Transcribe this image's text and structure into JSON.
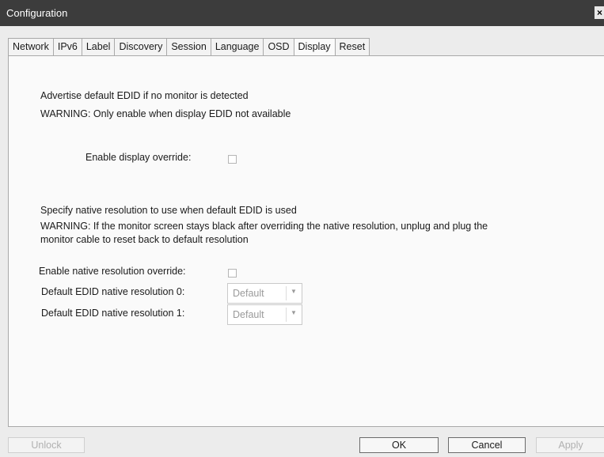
{
  "window": {
    "title": "Configuration",
    "close_label": "×"
  },
  "tabs": [
    {
      "label": "Network"
    },
    {
      "label": "IPv6"
    },
    {
      "label": "Label"
    },
    {
      "label": "Discovery"
    },
    {
      "label": "Session"
    },
    {
      "label": "Language"
    },
    {
      "label": "OSD"
    },
    {
      "label": "Display"
    },
    {
      "label": "Reset"
    }
  ],
  "active_tab": "Display",
  "display": {
    "edid_heading": "Advertise default EDID if no monitor is detected",
    "edid_warning": "WARNING: Only enable when display EDID not available",
    "override_label": "Enable display override:",
    "override_checked": false,
    "native_heading": "Specify native resolution to use when default EDID is used",
    "native_warning_line1": "WARNING: If the monitor screen stays black after overriding the native resolution, unplug and plug the",
    "native_warning_line2": "monitor cable to reset back to default resolution",
    "native_override_label": "Enable native resolution override:",
    "native_override_checked": false,
    "res0_label": "Default EDID native resolution 0:",
    "res0_value": "Default",
    "res1_label": "Default EDID native resolution 1:",
    "res1_value": "Default"
  },
  "buttons": {
    "unlock": "Unlock",
    "ok": "OK",
    "cancel": "Cancel",
    "apply": "Apply"
  }
}
